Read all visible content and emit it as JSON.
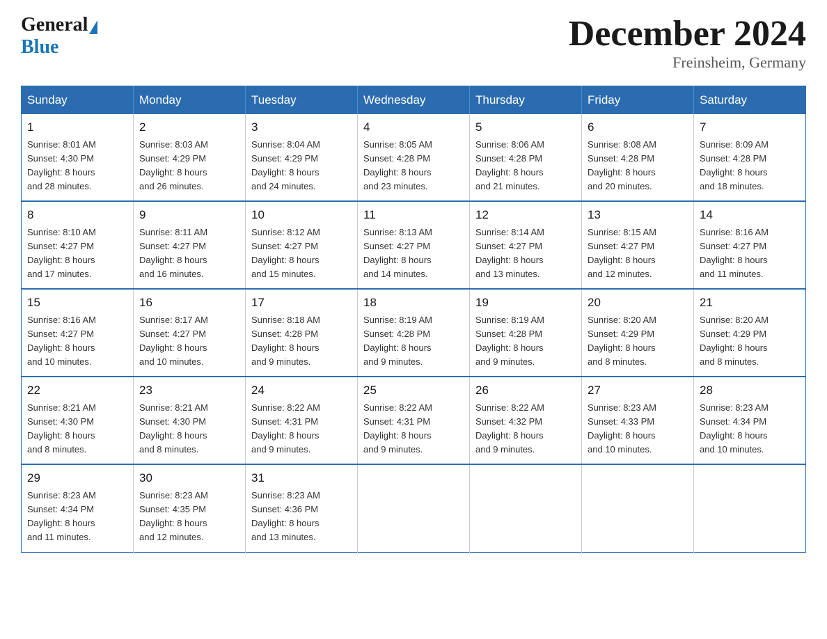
{
  "header": {
    "logo": {
      "text_general": "General",
      "text_blue": "Blue",
      "triangle_aria": "logo triangle"
    },
    "title": "December 2024",
    "location": "Freinsheim, Germany"
  },
  "calendar": {
    "days_of_week": [
      "Sunday",
      "Monday",
      "Tuesday",
      "Wednesday",
      "Thursday",
      "Friday",
      "Saturday"
    ],
    "weeks": [
      [
        {
          "day": "1",
          "sunrise": "8:01 AM",
          "sunset": "4:30 PM",
          "daylight": "8 hours and 28 minutes."
        },
        {
          "day": "2",
          "sunrise": "8:03 AM",
          "sunset": "4:29 PM",
          "daylight": "8 hours and 26 minutes."
        },
        {
          "day": "3",
          "sunrise": "8:04 AM",
          "sunset": "4:29 PM",
          "daylight": "8 hours and 24 minutes."
        },
        {
          "day": "4",
          "sunrise": "8:05 AM",
          "sunset": "4:28 PM",
          "daylight": "8 hours and 23 minutes."
        },
        {
          "day": "5",
          "sunrise": "8:06 AM",
          "sunset": "4:28 PM",
          "daylight": "8 hours and 21 minutes."
        },
        {
          "day": "6",
          "sunrise": "8:08 AM",
          "sunset": "4:28 PM",
          "daylight": "8 hours and 20 minutes."
        },
        {
          "day": "7",
          "sunrise": "8:09 AM",
          "sunset": "4:28 PM",
          "daylight": "8 hours and 18 minutes."
        }
      ],
      [
        {
          "day": "8",
          "sunrise": "8:10 AM",
          "sunset": "4:27 PM",
          "daylight": "8 hours and 17 minutes."
        },
        {
          "day": "9",
          "sunrise": "8:11 AM",
          "sunset": "4:27 PM",
          "daylight": "8 hours and 16 minutes."
        },
        {
          "day": "10",
          "sunrise": "8:12 AM",
          "sunset": "4:27 PM",
          "daylight": "8 hours and 15 minutes."
        },
        {
          "day": "11",
          "sunrise": "8:13 AM",
          "sunset": "4:27 PM",
          "daylight": "8 hours and 14 minutes."
        },
        {
          "day": "12",
          "sunrise": "8:14 AM",
          "sunset": "4:27 PM",
          "daylight": "8 hours and 13 minutes."
        },
        {
          "day": "13",
          "sunrise": "8:15 AM",
          "sunset": "4:27 PM",
          "daylight": "8 hours and 12 minutes."
        },
        {
          "day": "14",
          "sunrise": "8:16 AM",
          "sunset": "4:27 PM",
          "daylight": "8 hours and 11 minutes."
        }
      ],
      [
        {
          "day": "15",
          "sunrise": "8:16 AM",
          "sunset": "4:27 PM",
          "daylight": "8 hours and 10 minutes."
        },
        {
          "day": "16",
          "sunrise": "8:17 AM",
          "sunset": "4:27 PM",
          "daylight": "8 hours and 10 minutes."
        },
        {
          "day": "17",
          "sunrise": "8:18 AM",
          "sunset": "4:28 PM",
          "daylight": "8 hours and 9 minutes."
        },
        {
          "day": "18",
          "sunrise": "8:19 AM",
          "sunset": "4:28 PM",
          "daylight": "8 hours and 9 minutes."
        },
        {
          "day": "19",
          "sunrise": "8:19 AM",
          "sunset": "4:28 PM",
          "daylight": "8 hours and 9 minutes."
        },
        {
          "day": "20",
          "sunrise": "8:20 AM",
          "sunset": "4:29 PM",
          "daylight": "8 hours and 8 minutes."
        },
        {
          "day": "21",
          "sunrise": "8:20 AM",
          "sunset": "4:29 PM",
          "daylight": "8 hours and 8 minutes."
        }
      ],
      [
        {
          "day": "22",
          "sunrise": "8:21 AM",
          "sunset": "4:30 PM",
          "daylight": "8 hours and 8 minutes."
        },
        {
          "day": "23",
          "sunrise": "8:21 AM",
          "sunset": "4:30 PM",
          "daylight": "8 hours and 8 minutes."
        },
        {
          "day": "24",
          "sunrise": "8:22 AM",
          "sunset": "4:31 PM",
          "daylight": "8 hours and 9 minutes."
        },
        {
          "day": "25",
          "sunrise": "8:22 AM",
          "sunset": "4:31 PM",
          "daylight": "8 hours and 9 minutes."
        },
        {
          "day": "26",
          "sunrise": "8:22 AM",
          "sunset": "4:32 PM",
          "daylight": "8 hours and 9 minutes."
        },
        {
          "day": "27",
          "sunrise": "8:23 AM",
          "sunset": "4:33 PM",
          "daylight": "8 hours and 10 minutes."
        },
        {
          "day": "28",
          "sunrise": "8:23 AM",
          "sunset": "4:34 PM",
          "daylight": "8 hours and 10 minutes."
        }
      ],
      [
        {
          "day": "29",
          "sunrise": "8:23 AM",
          "sunset": "4:34 PM",
          "daylight": "8 hours and 11 minutes."
        },
        {
          "day": "30",
          "sunrise": "8:23 AM",
          "sunset": "4:35 PM",
          "daylight": "8 hours and 12 minutes."
        },
        {
          "day": "31",
          "sunrise": "8:23 AM",
          "sunset": "4:36 PM",
          "daylight": "8 hours and 13 minutes."
        },
        null,
        null,
        null,
        null
      ]
    ]
  },
  "labels": {
    "sunrise": "Sunrise:",
    "sunset": "Sunset:",
    "daylight": "Daylight:"
  }
}
